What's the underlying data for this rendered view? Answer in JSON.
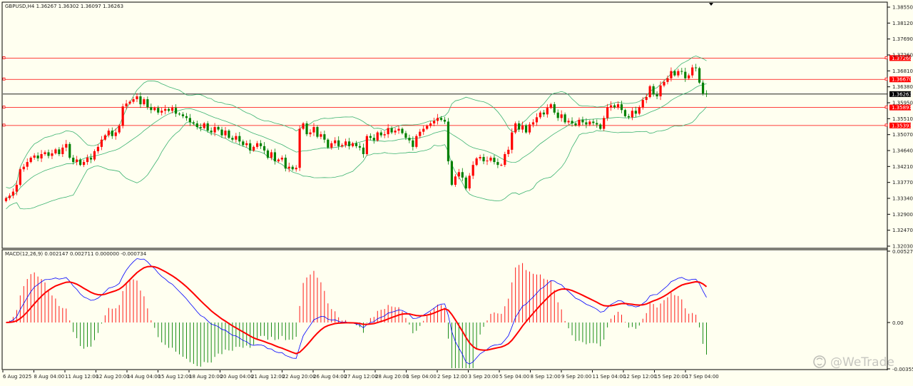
{
  "symbol": {
    "header": "GBPUSD,H4  1.36267 1.36302 1.36097 1.36263"
  },
  "macd": {
    "header": "MACD(12,26,9) 0.002147 0.002711 0.000000 -0.000734",
    "axis_labels": [
      "0.00527",
      "0.00",
      "-0.003553"
    ]
  },
  "watermark": {
    "text": "@WeTrade",
    "icon": "wechat-logo-icon"
  },
  "price_axis": {
    "labels": [
      "1.38550",
      "1.38120",
      "1.37690",
      "1.37260",
      "1.36810",
      "1.36380",
      "1.35950",
      "1.35510",
      "1.35070",
      "1.34640",
      "1.34210",
      "1.33770",
      "1.33340",
      "1.32900",
      "1.32470",
      "1.32030"
    ]
  },
  "horizontal_levels": [
    {
      "price": 1.3726,
      "label": "1.37260",
      "color": "#ff0000"
    },
    {
      "price": 1.3667,
      "label": "1.36670",
      "color": "#ff0000"
    },
    {
      "price": 1.35891,
      "label": "1.35891",
      "color": "#ff0000"
    },
    {
      "price": 1.35393,
      "label": "1.35393",
      "color": "#ff0000"
    }
  ],
  "current_price": {
    "price": 1.36263,
    "label": "1.36263",
    "color": "#000000"
  },
  "time_axis": {
    "labels": [
      "6 Aug 2025",
      "8 Aug 04:00",
      "11 Aug 12:00",
      "12 Aug 20:00",
      "14 Aug 04:00",
      "15 Aug 12:00",
      "18 Aug 20:00",
      "20 Aug 04:00",
      "21 Aug 12:00",
      "22 Aug 20:00",
      "26 Aug 04:00",
      "27 Aug 12:00",
      "28 Aug 20:00",
      "1 Sep 04:00",
      "2 Sep 12:00",
      "3 Sep 20:00",
      "5 Sep 04:00",
      "8 Sep 12:00",
      "9 Sep 20:00",
      "11 Sep 04:00",
      "12 Sep 12:00",
      "15 Sep 20:00",
      "17 Sep 04:00"
    ]
  },
  "colors": {
    "background": "#fffff0",
    "bull_candle": "#ff0000",
    "bear_candle": "#008000",
    "bands": "#3cb371",
    "macd_line": "#0000ff",
    "signal_line": "#ff0000",
    "hist_positive": "#ff0000",
    "hist_negative": "#008000"
  },
  "chart_data": {
    "type": "candlestick",
    "series_name": "GBPUSD,H4",
    "y_range": [
      1.3203,
      1.3875
    ],
    "closes": [
      1.3338,
      1.3345,
      1.3356,
      1.3375,
      1.3418,
      1.3425,
      1.3438,
      1.345,
      1.3456,
      1.3448,
      1.346,
      1.3465,
      1.3455,
      1.3462,
      1.3473,
      1.346,
      1.3478,
      1.3488,
      1.345,
      1.3438,
      1.3445,
      1.343,
      1.3438,
      1.345,
      1.3445,
      1.3468,
      1.348,
      1.35,
      1.3512,
      1.3525,
      1.351,
      1.352,
      1.3538,
      1.3592,
      1.36,
      1.3605,
      1.3612,
      1.362,
      1.3598,
      1.3612,
      1.359,
      1.3582,
      1.3588,
      1.3575,
      1.358,
      1.3585,
      1.358,
      1.3588,
      1.3572,
      1.357,
      1.3565,
      1.356,
      1.3548,
      1.3545,
      1.3535,
      1.3532,
      1.3545,
      1.3525,
      1.352,
      1.3535,
      1.3528,
      1.3512,
      1.3525,
      1.3505,
      1.35,
      1.351,
      1.3495,
      1.3485,
      1.349,
      1.347,
      1.348,
      1.349,
      1.3482,
      1.347,
      1.345,
      1.3465,
      1.344,
      1.3445,
      1.345,
      1.342,
      1.3425,
      1.3418,
      1.3422,
      1.353,
      1.3545,
      1.3515,
      1.352,
      1.3535,
      1.3508,
      1.3515,
      1.35,
      1.3478,
      1.349,
      1.3498,
      1.3482,
      1.3485,
      1.3495,
      1.3482,
      1.349,
      1.3482,
      1.3478,
      1.346,
      1.351,
      1.3505,
      1.3498,
      1.352,
      1.3512,
      1.3515,
      1.3532,
      1.352,
      1.3525,
      1.353,
      1.3518,
      1.3505,
      1.3498,
      1.348,
      1.351,
      1.3522,
      1.353,
      1.3538,
      1.3545,
      1.3552,
      1.356,
      1.3555,
      1.355,
      1.344,
      1.3375,
      1.3398,
      1.341,
      1.3395,
      1.3365,
      1.34,
      1.343,
      1.3448,
      1.3452,
      1.344,
      1.3442,
      1.345,
      1.3438,
      1.343,
      1.343,
      1.346,
      1.3472,
      1.352,
      1.3545,
      1.3528,
      1.354,
      1.352,
      1.3542,
      1.3548,
      1.3562,
      1.3575,
      1.357,
      1.3588,
      1.3598,
      1.3575,
      1.356,
      1.357,
      1.3548,
      1.3552,
      1.3545,
      1.354,
      1.3555,
      1.3548,
      1.3542,
      1.355,
      1.3546,
      1.3542,
      1.353,
      1.356,
      1.359,
      1.3595,
      1.359,
      1.3598,
      1.3582,
      1.3565,
      1.3562,
      1.358,
      1.3572,
      1.359,
      1.361,
      1.3618,
      1.3648,
      1.3625,
      1.362,
      1.365,
      1.366,
      1.367,
      1.369,
      1.3678,
      1.369,
      1.3688,
      1.367,
      1.3678,
      1.37,
      1.3698,
      1.3658,
      1.3628,
      1.3626
    ]
  }
}
